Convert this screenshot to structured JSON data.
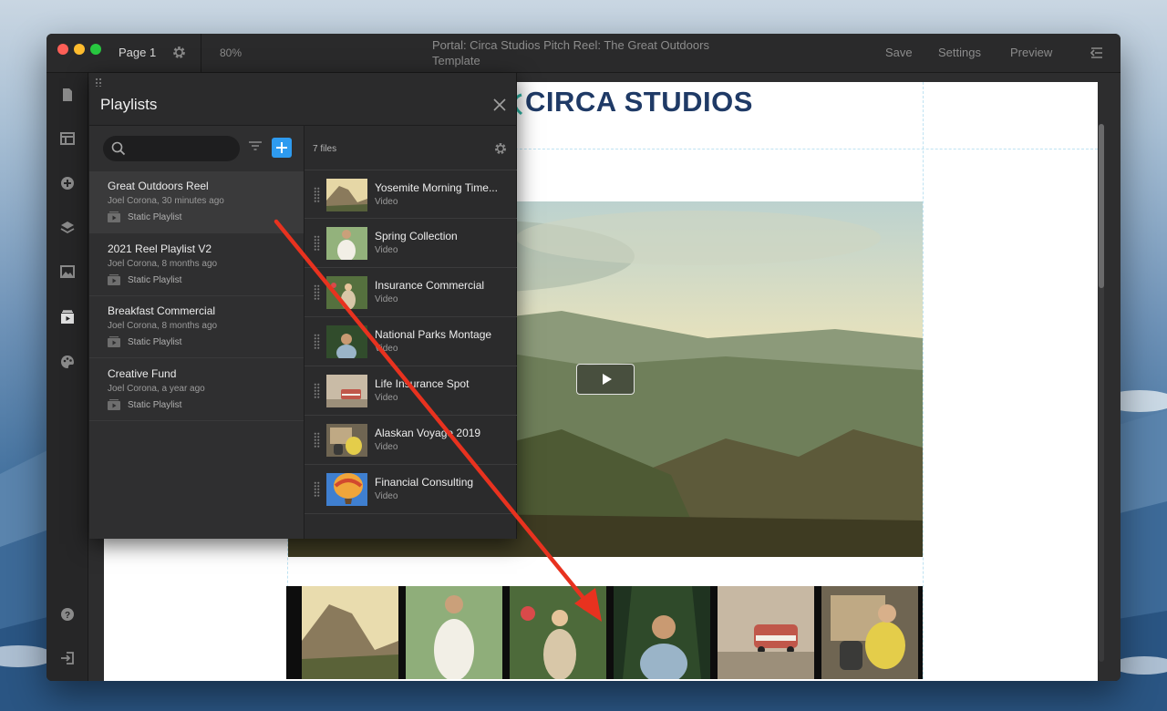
{
  "window": {
    "page_label": "Page 1",
    "zoom": "80%",
    "doc_title": "Portal: Circa Studios Pitch Reel: The Great Outdoors Template",
    "save_label": "Save",
    "settings_label": "Settings",
    "preview_label": "Preview"
  },
  "canvas": {
    "brand_name": "CIRCA STUDIOS"
  },
  "playlists_panel": {
    "title": "Playlists",
    "search": {
      "value": "",
      "placeholder": ""
    },
    "playlists": [
      {
        "name": "Great Outdoors Reel",
        "meta": "Joel Corona, 30 minutes ago",
        "type": "Static Playlist",
        "selected": true
      },
      {
        "name": "2021 Reel Playlist V2",
        "meta": "Joel Corona, 8 months ago",
        "type": "Static Playlist",
        "selected": false
      },
      {
        "name": "Breakfast Commercial",
        "meta": "Joel Corona, 8 months ago",
        "type": "Static Playlist",
        "selected": false
      },
      {
        "name": "Creative Fund",
        "meta": "Joel Corona, a year ago",
        "type": "Static Playlist",
        "selected": false
      }
    ],
    "files_count": "7 files",
    "files": [
      {
        "name": "Yosemite Morning Time...",
        "type": "Video"
      },
      {
        "name": "Spring Collection",
        "type": "Video"
      },
      {
        "name": "Insurance Commercial",
        "type": "Video"
      },
      {
        "name": "National Parks Montage",
        "type": "Video"
      },
      {
        "name": "Life Insurance Spot",
        "type": "Video"
      },
      {
        "name": "Alaskan Voyage 2019",
        "type": "Video"
      },
      {
        "name": "Financial Consulting",
        "type": "Video"
      }
    ]
  },
  "colors": {
    "accent_blue": "#2e9bf0",
    "brand_navy": "#1f3a66",
    "arrow_red": "#e8321f"
  }
}
